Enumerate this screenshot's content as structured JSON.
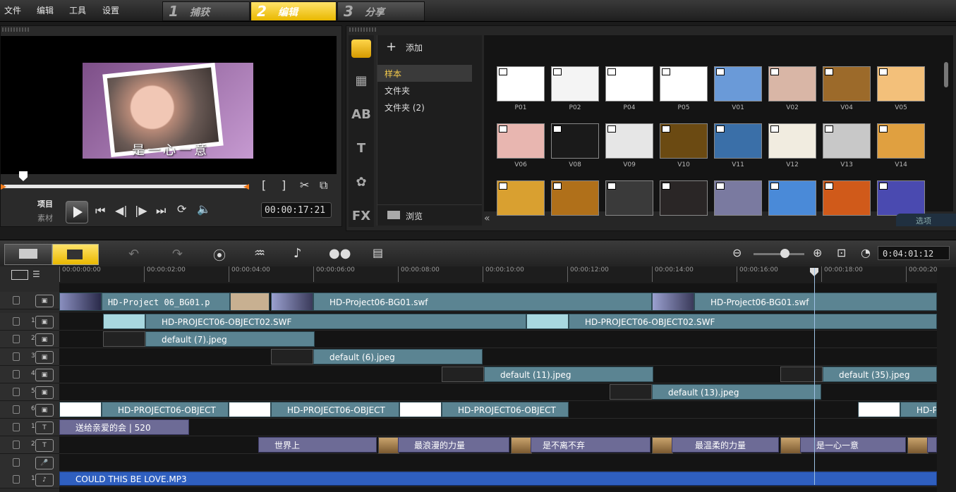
{
  "menu": [
    "文件",
    "编辑",
    "工具",
    "设置"
  ],
  "steps": [
    {
      "num": "1",
      "label": "捕获",
      "active": false
    },
    {
      "num": "2",
      "label": "编辑",
      "active": true
    },
    {
      "num": "3",
      "label": "分享",
      "active": false
    }
  ],
  "preview": {
    "caption": "是一心一意",
    "mode_project": "项目",
    "mode_clip": "素材",
    "timecode": "00:00:17:21",
    "mark_in": "[",
    "mark_out": "]"
  },
  "library": {
    "add_label": "添加",
    "browse_label": "浏览",
    "folders": [
      "样本",
      "文件夹",
      "文件夹 (2)"
    ],
    "options_label": "选项",
    "thumbnails": [
      {
        "label": "P01",
        "color": "#ffffff"
      },
      {
        "label": "P02",
        "color": "#f4f4f4"
      },
      {
        "label": "P04",
        "color": "#ffffff"
      },
      {
        "label": "P05",
        "color": "#ffffff"
      },
      {
        "label": "V01",
        "color": "#6a9ad8"
      },
      {
        "label": "V02",
        "color": "#d9b6a6"
      },
      {
        "label": "V04",
        "color": "#9c6a2a"
      },
      {
        "label": "V05",
        "color": "#f3c07a"
      },
      {
        "label": "V06",
        "color": "#e8b6b0"
      },
      {
        "label": "V08",
        "color": "#1a1a1a"
      },
      {
        "label": "V09",
        "color": "#e6e6e6"
      },
      {
        "label": "V10",
        "color": "#6b4a12"
      },
      {
        "label": "V11",
        "color": "#3a6fa8"
      },
      {
        "label": "V12",
        "color": "#f1ece0"
      },
      {
        "label": "V13",
        "color": "#c8c8c8"
      },
      {
        "label": "V14",
        "color": "#e0a040"
      },
      {
        "label": "",
        "color": "#d9a030"
      },
      {
        "label": "",
        "color": "#b0701a"
      },
      {
        "label": "",
        "color": "#3a3a3a"
      },
      {
        "label": "",
        "color": "#2a2626"
      },
      {
        "label": "",
        "color": "#7a7aa0"
      },
      {
        "label": "",
        "color": "#4a8ad8"
      },
      {
        "label": "",
        "color": "#d05a1a"
      },
      {
        "label": "",
        "color": "#4a4ab0"
      }
    ]
  },
  "timeline": {
    "timecode": "0:04:01:12",
    "ruler": [
      "00:00:00:00",
      "00:00:02:00",
      "00:00:04:00",
      "00:00:06:00",
      "00:00:08:00",
      "00:00:10:00",
      "00:00:12:00",
      "00:00:14:00",
      "00:00:16:00",
      "00:00:18:00",
      "00:00:20"
    ],
    "track_numbers": [
      "",
      "1",
      "2",
      "3",
      "4",
      "5",
      "6",
      "1",
      "2",
      "",
      "1"
    ],
    "clips": {
      "bg_a": "HD-Project 06_BG01.p",
      "bg_b": "HD-Project06-BG01.swf",
      "bg_c": "HD-Project06-BG01.swf",
      "obj_a": "HD-PROJECT06-OBJECT02.SWF",
      "obj_b": "HD-PROJECT06-OBJECT02.SWF",
      "img7": "default (7).jpeg",
      "img6": "default (6).jpeg",
      "img11": "default (11).jpeg",
      "img35": "default (35).jpeg",
      "img13": "default (13).jpeg",
      "ov_a": "HD-PROJECT06-OBJECT",
      "ov_b": "HD-PROJECT06-OBJECT",
      "ov_c": "HD-PROJECT06-OBJECT",
      "ov_d": "HD-P",
      "title1": "送给亲爱的会 | 520",
      "t2a": "世界上",
      "t2b": "最浪漫的力量",
      "t2c": "是不离不弃",
      "t2d": "最温柔的力量",
      "t2e": "是一心一意",
      "music": "COULD THIS BE LOVE.MP3"
    }
  }
}
